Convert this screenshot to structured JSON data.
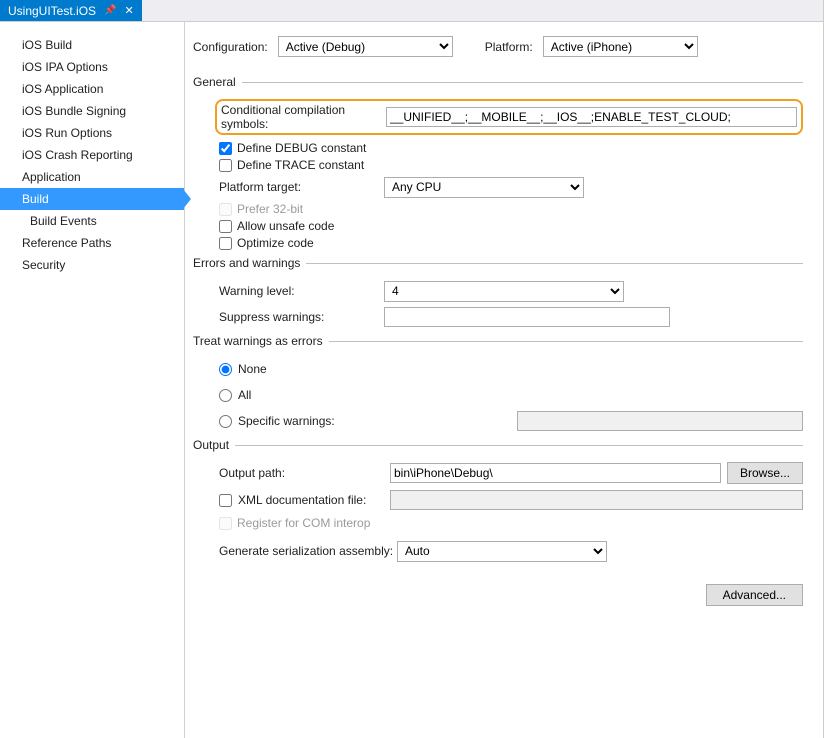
{
  "tab": {
    "title": "UsingUITest.iOS"
  },
  "sidebar": {
    "items": [
      {
        "label": "iOS Build",
        "active": false,
        "sub": false
      },
      {
        "label": "iOS IPA Options",
        "active": false,
        "sub": false
      },
      {
        "label": "iOS Application",
        "active": false,
        "sub": false
      },
      {
        "label": "iOS Bundle Signing",
        "active": false,
        "sub": false
      },
      {
        "label": "iOS Run Options",
        "active": false,
        "sub": false
      },
      {
        "label": "iOS Crash Reporting",
        "active": false,
        "sub": false
      },
      {
        "label": "Application",
        "active": false,
        "sub": false
      },
      {
        "label": "Build",
        "active": true,
        "sub": false
      },
      {
        "label": "Build Events",
        "active": false,
        "sub": true
      },
      {
        "label": "Reference Paths",
        "active": false,
        "sub": false
      },
      {
        "label": "Security",
        "active": false,
        "sub": false
      }
    ]
  },
  "config": {
    "configuration_label": "Configuration:",
    "configuration_value": "Active (Debug)",
    "platform_label": "Platform:",
    "platform_value": "Active (iPhone)"
  },
  "general": {
    "header": "General",
    "cond_sym_label": "Conditional compilation symbols:",
    "cond_sym_value": "__UNIFIED__;__MOBILE__;__IOS__;ENABLE_TEST_CLOUD;",
    "debug_label": "Define DEBUG constant",
    "debug_checked": true,
    "trace_label": "Define TRACE constant",
    "trace_checked": false,
    "platform_target_label": "Platform target:",
    "platform_target_value": "Any CPU",
    "prefer32_label": "Prefer 32-bit",
    "unsafe_label": "Allow unsafe code",
    "optimize_label": "Optimize code"
  },
  "errors": {
    "header": "Errors and warnings",
    "warning_level_label": "Warning level:",
    "warning_level_value": "4",
    "suppress_label": "Suppress warnings:",
    "suppress_value": ""
  },
  "treat": {
    "header": "Treat warnings as errors",
    "none_label": "None",
    "all_label": "All",
    "specific_label": "Specific warnings:",
    "specific_value": "",
    "selected": "none"
  },
  "output": {
    "header": "Output",
    "path_label": "Output path:",
    "path_value": "bin\\iPhone\\Debug\\",
    "browse_label": "Browse...",
    "xml_label": "XML documentation file:",
    "xml_value": "",
    "register_com_label": "Register for COM interop",
    "gen_ser_label": "Generate serialization assembly:",
    "gen_ser_value": "Auto"
  },
  "advanced_label": "Advanced..."
}
